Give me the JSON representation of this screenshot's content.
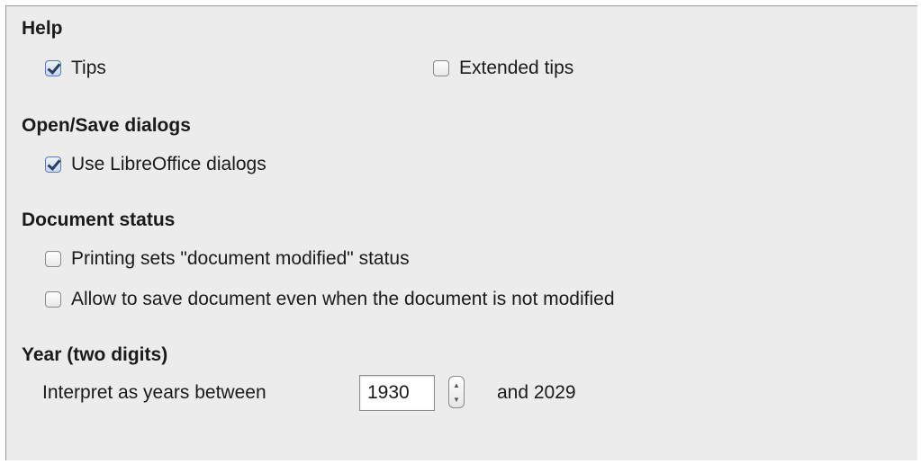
{
  "help": {
    "heading": "Help",
    "tips": {
      "label": "Tips",
      "checked": true
    },
    "extended_tips": {
      "label": "Extended tips",
      "checked": false
    }
  },
  "open_save": {
    "heading": "Open/Save dialogs",
    "use_libreoffice_dialogs": {
      "label": "Use LibreOffice dialogs",
      "checked": true
    }
  },
  "document_status": {
    "heading": "Document status",
    "printing_sets_modified": {
      "label": "Printing sets \"document modified\" status",
      "checked": false
    },
    "allow_save_unmodified": {
      "label": "Allow to save document even when the document is not modified",
      "checked": false
    }
  },
  "year": {
    "heading": "Year (two digits)",
    "interpret_label": "Interpret as years between",
    "start_year": "1930",
    "and_label": "and 2029",
    "spin_up_icon": "▲",
    "spin_down_icon": "▼"
  }
}
